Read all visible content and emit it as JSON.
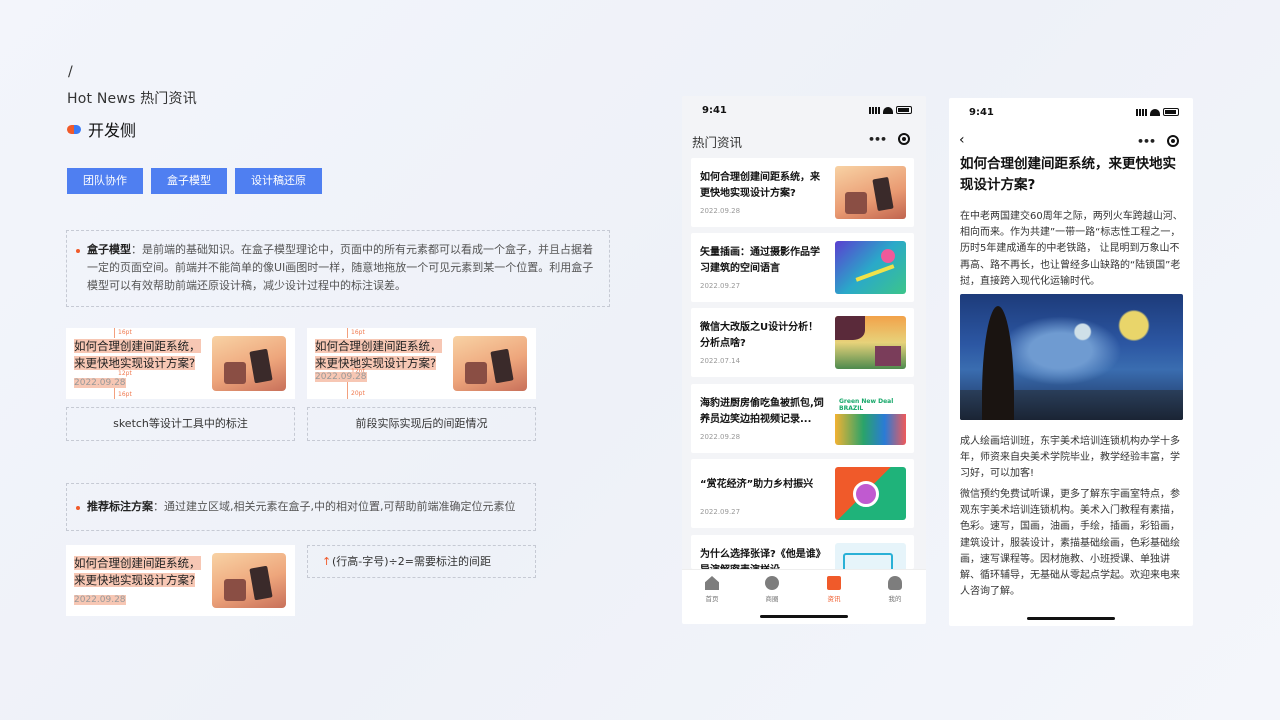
{
  "header": {
    "slash": "/",
    "title": "Hot News  热门资讯",
    "dev_label": "开发侧"
  },
  "tabs": [
    "团队协作",
    "盒子模型",
    "设计稿还原"
  ],
  "box_model": {
    "term": "盒子模型",
    "text": "：是前端的基础知识。在盒子模型理论中，页面中的所有元素都可以看成一个盒子，并且占据着一定的页面空间。前端并不能简单的像UI画图时一样，随意地拖放一个可见元素到某一个位置。利用盒子模型可以有效帮助前端还原设计稿，减少设计过程中的标注误差。"
  },
  "sample_card": {
    "title": "如何合理创建间距系统，来更快地实现设计方案?",
    "date": "2022.09.28"
  },
  "annotations": {
    "a16": "16pt",
    "a12": "12pt",
    "a20": "20pt"
  },
  "captions": {
    "sketch": "sketch等设计工具中的标注",
    "actual": "前段实际实现后的间距情况"
  },
  "recommend": {
    "term": "推荐标注方案",
    "text": "：通过建立区域,相关元素在盒子,中的相对位置,可帮助前端准确定位元素位置。"
  },
  "formula": "(行高-字号)÷2=需要标注的间距",
  "phone1": {
    "time": "9:41",
    "nav_title": "热门资讯",
    "news": [
      {
        "title": "如何合理创建间距系统，来更快地实现设计方案?",
        "date": "2022.09.28"
      },
      {
        "title": "矢量插画：通过摄影作品学习建筑的空间语言",
        "date": "2022.09.27"
      },
      {
        "title": "微信大改版之U设计分析！分析点啥?",
        "date": "2022.07.14"
      },
      {
        "title": "海豹进厨房偷吃鱼被抓包,饲养员边笑边拍视频记录...",
        "date": "2022.09.28"
      },
      {
        "title": "“赏花经济”助力乡村振兴",
        "date": "2022.09.27"
      },
      {
        "title": "为什么选择张译?《他是谁》导演解密表演样设",
        "date": ""
      }
    ],
    "thumb_text": "Green New Deal BRAZIL",
    "tabbar": [
      {
        "label": "首页",
        "active": false
      },
      {
        "label": "商圈",
        "active": false
      },
      {
        "label": "资讯",
        "active": true
      },
      {
        "label": "我的",
        "active": false
      }
    ],
    "active_color": "#f05a2a"
  },
  "phone2": {
    "time": "9:41",
    "title": "如何合理创建间距系统，来更快地实现设计方案?",
    "p1": "在中老两国建交60周年之际，两列火车跨越山河、相向而来。作为共建”一带一路“标志性工程之一，历时5年建成通车的中老铁路， 让昆明到万象山不再高、路不再长，也让曾经多山缺路的“陆锁国”老挝，直接跨入现代化运输时代。",
    "p2": "成人绘画培训班，东宇美术培训连锁机构办学十多年，师资来自央美术学院毕业，教学经验丰富，学习好，可以加客!",
    "p3": "微信预约免费试听课，更多了解东宇画室特点，参观东宇美术培训连锁机构。美术入门教程有素描，色彩。速写，国画，油画，手绘，插画，彩铅画，建筑设计，服装设计，素描基础绘画，色彩基础绘画，速写课程等。因材施教、小班授课、单独讲解、循环辅导，无基础从零起点学起。欢迎来电来人咨询了解。"
  }
}
